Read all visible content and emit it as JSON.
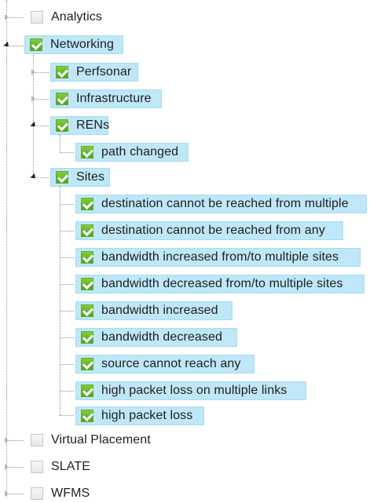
{
  "tree": {
    "nodes": [
      {
        "label": "Analytics",
        "checked": false,
        "selected": false,
        "expanded": false
      },
      {
        "label": "Networking",
        "checked": true,
        "selected": true,
        "expanded": true,
        "children": [
          {
            "label": "Perfsonar",
            "checked": true,
            "selected": true,
            "expanded": false
          },
          {
            "label": "Infrastructure",
            "checked": true,
            "selected": true,
            "expanded": false
          },
          {
            "label": "RENs",
            "checked": true,
            "selected": true,
            "expanded": true,
            "children": [
              {
                "label": "path changed",
                "checked": true,
                "selected": true
              }
            ]
          },
          {
            "label": "Sites",
            "checked": true,
            "selected": true,
            "expanded": true,
            "children": [
              {
                "label": "destination cannot be reached from multiple",
                "checked": true,
                "selected": true
              },
              {
                "label": "destination cannot be reached from any",
                "checked": true,
                "selected": true
              },
              {
                "label": "bandwidth increased from/to multiple sites",
                "checked": true,
                "selected": true
              },
              {
                "label": "bandwidth decreased from/to multiple sites",
                "checked": true,
                "selected": true
              },
              {
                "label": "bandwidth increased",
                "checked": true,
                "selected": true
              },
              {
                "label": "bandwidth decreased",
                "checked": true,
                "selected": true
              },
              {
                "label": "source cannot reach any",
                "checked": true,
                "selected": true
              },
              {
                "label": "high packet loss on multiple links",
                "checked": true,
                "selected": true
              },
              {
                "label": "high packet loss",
                "checked": true,
                "selected": true
              }
            ]
          }
        ]
      },
      {
        "label": "Virtual Placement",
        "checked": false,
        "selected": false,
        "expanded": false
      },
      {
        "label": "SLATE",
        "checked": false,
        "selected": false,
        "expanded": false
      },
      {
        "label": "WFMS",
        "checked": false,
        "selected": false,
        "expanded": false
      }
    ]
  }
}
